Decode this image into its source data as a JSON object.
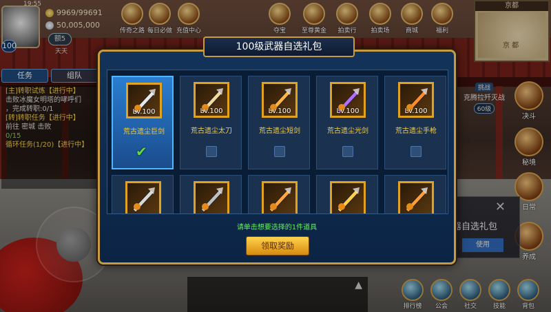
{
  "hud": {
    "time": "19:55",
    "gold": "9969/99691",
    "coins": "50,005,000",
    "vip": "额5",
    "tiantian": "天天",
    "level": "100"
  },
  "top_icons": [
    {
      "label": "传奇之路",
      "icon": "legend-road-icon"
    },
    {
      "label": "每日必做",
      "icon": "daily-icon"
    },
    {
      "label": "充值中心",
      "icon": "recharge-icon"
    },
    {
      "label": "夺宝",
      "icon": "treasure-icon"
    },
    {
      "label": "至尊黄金",
      "icon": "gold-icon"
    },
    {
      "label": "拍卖行",
      "icon": "auction-icon"
    },
    {
      "label": "拍卖场",
      "icon": "auction-hall-icon"
    },
    {
      "label": "商城",
      "icon": "shop-icon"
    },
    {
      "label": "福利",
      "icon": "welfare-icon"
    }
  ],
  "minimap": {
    "region": "京都",
    "city": "京 都"
  },
  "quest": {
    "tabs": [
      "任务",
      "组队"
    ],
    "lines": [
      {
        "text": "[主]转职试炼【进行中】",
        "kind": "title"
      },
      {
        "text": "击败冰魔女明塔的哮呼们",
        "kind": "desc"
      },
      {
        "text": "，完成转职:0/1",
        "kind": "desc"
      },
      {
        "text": "[转]转职任务【进行中】",
        "kind": "title"
      },
      {
        "text": "前往 密城 击败",
        "kind": "desc"
      },
      {
        "text": "0/15",
        "kind": "green"
      },
      {
        "text": "循环任务(1/20)【进行中】",
        "kind": "title"
      }
    ]
  },
  "side": {
    "kfz_tag": "挑战",
    "kfz_name": "克腾拉歼灭战",
    "kfz_level": "60级",
    "buttons": [
      {
        "label": "决斗",
        "icon": "duel-icon"
      },
      {
        "label": "秘境",
        "icon": "secret-realm-icon"
      },
      {
        "label": "日常",
        "icon": "daily-routine-icon"
      },
      {
        "label": "养成",
        "icon": "cultivate-icon"
      }
    ]
  },
  "bg_tip": {
    "text": "器自选礼包",
    "prefix": "郊",
    "use": "使用",
    "close": "✕"
  },
  "bottom": [
    {
      "label": "排行榜",
      "icon": "rank-icon"
    },
    {
      "label": "公会",
      "icon": "guild-icon"
    },
    {
      "label": "社交",
      "icon": "social-icon"
    },
    {
      "label": "技能",
      "icon": "skill-icon"
    },
    {
      "label": "背包",
      "icon": "bag-icon"
    }
  ],
  "dialog": {
    "title": "100级武器自选礼包",
    "hint": "请单击想要选择的1件道具",
    "claim": "领取奖励",
    "items": [
      {
        "name": "荒古遗尘巨剑",
        "level": "Lv.100",
        "selected": true,
        "weapon": "greatsword"
      },
      {
        "name": "荒古遗尘太刀",
        "level": "Lv.100",
        "selected": false,
        "weapon": "katana"
      },
      {
        "name": "荒古遗尘短剑",
        "level": "Lv.100",
        "selected": false,
        "weapon": "shortsword"
      },
      {
        "name": "荒古遗尘光剑",
        "level": "Lv.100",
        "selected": false,
        "weapon": "lightsaber"
      },
      {
        "name": "荒古遗尘手枪",
        "level": "Lv.100",
        "selected": false,
        "weapon": "pistol"
      },
      {
        "name": "",
        "level": "",
        "selected": false,
        "weapon": "gauntlet"
      },
      {
        "name": "",
        "level": "",
        "selected": false,
        "weapon": "claw"
      },
      {
        "name": "",
        "level": "",
        "selected": false,
        "weapon": "staff"
      },
      {
        "name": "",
        "level": "",
        "selected": false,
        "weapon": "axe"
      },
      {
        "name": "",
        "level": "",
        "selected": false,
        "weapon": "cannon"
      }
    ]
  }
}
